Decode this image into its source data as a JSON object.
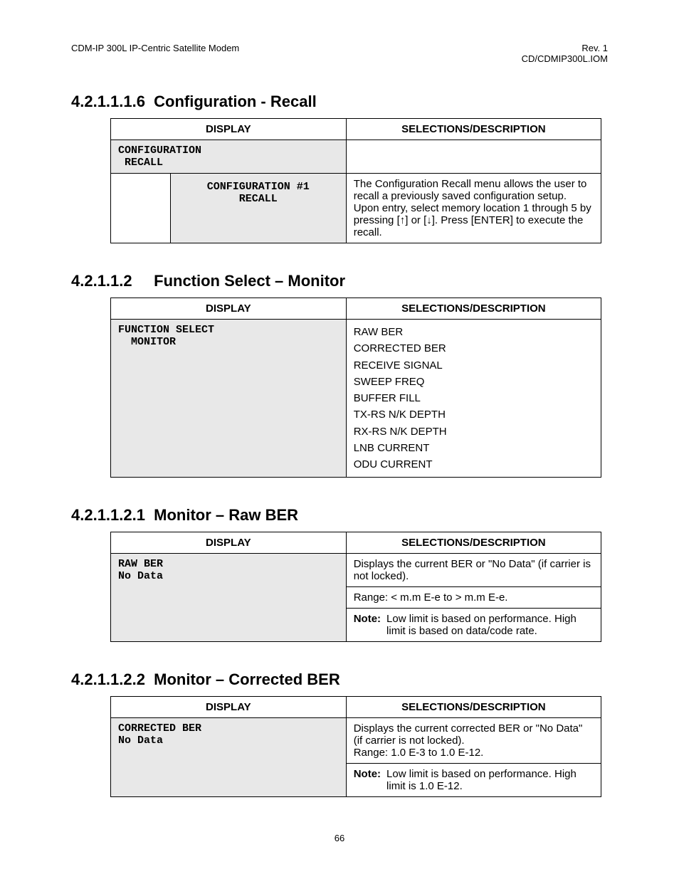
{
  "header": {
    "left": "CDM-IP 300L IP-Centric Satellite Modem",
    "right1": "Rev. 1",
    "right2": "CD/CDMIP300L.IOM"
  },
  "sections": {
    "s1": {
      "num": "4.2.1.1.1.6",
      "title": "Configuration - Recall"
    },
    "s2": {
      "num": "4.2.1.1.2",
      "title": "Function Select – Monitor"
    },
    "s3": {
      "num": "4.2.1.1.2.1",
      "title": "Monitor – Raw BER"
    },
    "s4": {
      "num": "4.2.1.1.2.2",
      "title": "Monitor – Corrected BER"
    }
  },
  "table_headers": {
    "display": "DISPLAY",
    "desc": "SELECTIONS/DESCRIPTION"
  },
  "t1": {
    "row1_display": "CONFIGURATION\n RECALL",
    "row1_desc": "",
    "row2_display": "CONFIGURATION #1\nRECALL",
    "row2_desc": "The Configuration Recall menu allows the user to recall a previously saved configuration setup. Upon entry, select memory location 1 through 5 by pressing [↑] or [↓]. Press [ENTER] to execute the recall."
  },
  "t2": {
    "row1_display": "FUNCTION SELECT\n  MONITOR",
    "options": [
      "RAW BER",
      "CORRECTED BER",
      "RECEIVE SIGNAL",
      "SWEEP FREQ",
      "BUFFER FILL",
      "TX-RS N/K DEPTH",
      "RX-RS N/K DEPTH",
      "LNB CURRENT",
      "ODU CURRENT"
    ]
  },
  "t3": {
    "row1_display": "RAW BER\nNo Data",
    "desc1": "Displays the current BER or \"No Data\" (if carrier is not locked).",
    "desc2": "Range: < m.m E-e to > m.m E-e.",
    "note_label": "Note:",
    "note_text": "Low limit is based on performance. High limit is based on data/code rate."
  },
  "t4": {
    "row1_display": "CORRECTED BER\nNo Data",
    "desc1": "Displays the current corrected BER or \"No Data\" (if carrier is not locked).\nRange: 1.0 E-3 to 1.0 E-12.",
    "note_label": "Note:",
    "note_text": "Low limit is based on performance. High limit is 1.0 E-12."
  },
  "page_number": "66"
}
